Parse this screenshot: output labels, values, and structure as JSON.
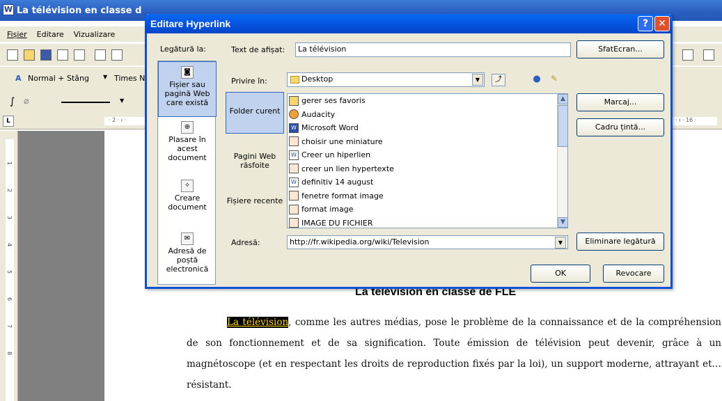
{
  "window": {
    "title": "La télévision en classe d"
  },
  "menu": [
    "Fișier",
    "Editare",
    "Vizualizare"
  ],
  "toolbar": {
    "style": "Normal + Stâng",
    "font": "Times Ne"
  },
  "ruler": {
    "marks": "· 2 · ı ·",
    "right": "· ı · 16 · "
  },
  "vruler": [
    "1",
    "2",
    "3",
    "4",
    "5",
    "6",
    "7",
    "8"
  ],
  "document": {
    "heading": "La télévision en classe de FLE",
    "link_text": "La télévision",
    "paragraph": ", comme les autres médias, pose le problème de la connaissance et de la compréhension de son fonctionnement et de  sa  signification. Toute émission de télévision peut devenir, grâce à un magnétoscope (et en respectant les droits de reproduction fixés par la loi), un support moderne, attrayant et…résistant."
  },
  "dialog": {
    "title": "Editare Hyperlink",
    "link_to_label": "Legătură la:",
    "display_text_label": "Text de afișat:",
    "display_text_value": "La télévision",
    "screentip_button": "SfatEcran...",
    "look_in_label": "Privire în:",
    "look_in_value": "Desktop",
    "bookmark_button": "Marcaj...",
    "target_frame_button": "Cadru țintă...",
    "address_label": "Adresă:",
    "address_value": "http://fr.wikipedia.org/wiki/Television",
    "remove_link_button": "Eliminare legătură",
    "ok_button": "OK",
    "cancel_button": "Revocare",
    "link_types": [
      {
        "label": "Fișier sau pagină Web care există"
      },
      {
        "label": "Plasare în acest document"
      },
      {
        "label": "Creare document"
      },
      {
        "label": "Adresă de poștă electronică"
      }
    ],
    "browse_types": [
      {
        "label": "Folder curent"
      },
      {
        "label": "Pagini Web răsfoite"
      },
      {
        "label": "Fișiere recente"
      }
    ],
    "files": [
      {
        "name": "gerer ses favoris",
        "icon": "folder-icon"
      },
      {
        "name": "Audacity",
        "icon": "app-icon"
      },
      {
        "name": "Microsoft Word",
        "icon": "word-icon"
      },
      {
        "name": "choisir une miniature",
        "icon": "shortcut-icon"
      },
      {
        "name": "Creer un hiperlien",
        "icon": "word-doc-icon"
      },
      {
        "name": "creer un lien hypertexte",
        "icon": "shortcut-icon"
      },
      {
        "name": "definitiv 14 august",
        "icon": "word-doc-icon"
      },
      {
        "name": "fenetre format image",
        "icon": "shortcut-icon"
      },
      {
        "name": "format image",
        "icon": "shortcut-icon"
      },
      {
        "name": "IMAGE DU FICHIER",
        "icon": "shortcut-icon"
      }
    ]
  }
}
